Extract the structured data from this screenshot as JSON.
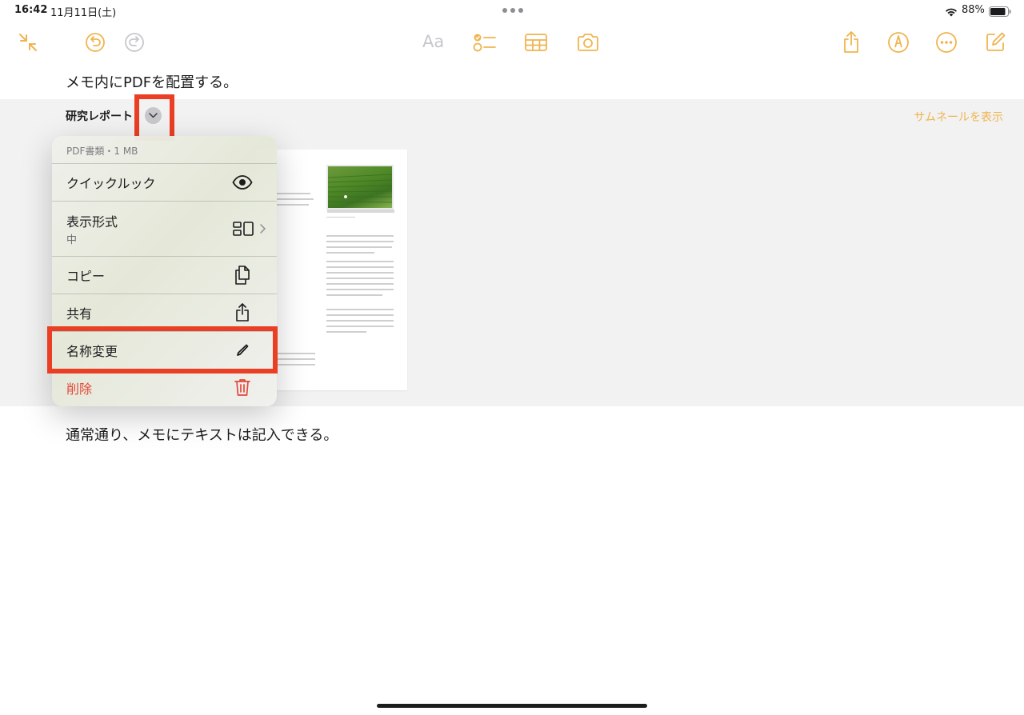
{
  "status_bar": {
    "time": "16:42",
    "date": "11月11日(土)",
    "battery_percent": "88%",
    "battery_level": 0.88
  },
  "toolbar": {
    "text_format_label": "Aa",
    "accent_color": "#F0B44E"
  },
  "note": {
    "line1": "メモ内にPDFを配置する。",
    "line2": "通常通り、メモにテキストは記入できる。",
    "attachment": {
      "title": "研究レポート",
      "show_thumbnail_link": "サムネールを表示"
    }
  },
  "context_menu": {
    "header": "PDF書類・1 MB",
    "items": [
      {
        "label": "クイックルック",
        "icon": "eye-icon"
      },
      {
        "label": "表示形式",
        "sublabel": "中",
        "icon": "view-style-icon"
      },
      {
        "label": "コピー",
        "icon": "copy-icon"
      },
      {
        "label": "共有",
        "icon": "share-icon"
      },
      {
        "label": "名称変更",
        "icon": "pencil-icon"
      },
      {
        "label": "削除",
        "icon": "trash-icon",
        "color": "#E5483B"
      }
    ]
  },
  "highlight_color": "#EA3F24"
}
